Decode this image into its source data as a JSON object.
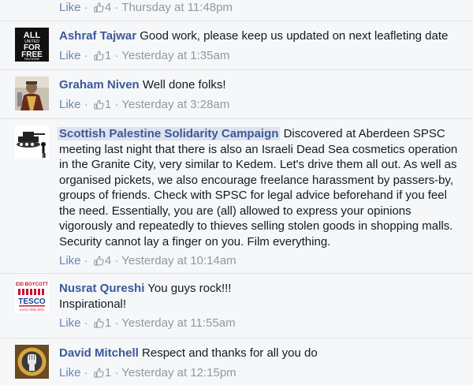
{
  "comments": [
    {
      "author": "",
      "text": "",
      "like_label": "Like",
      "likes": "4",
      "time": "Thursday at 11:48pm",
      "avatar": "none"
    },
    {
      "author": "Ashraf Tajwar",
      "text": "Good work, please keep us updated on next leafleting date",
      "like_label": "Like",
      "likes": "1",
      "time": "Yesterday at 1:35am",
      "avatar": "all-united-for-free-palestine-logo",
      "avatar_text": [
        "ALL",
        "UNITED",
        "FOR",
        "FREE",
        "PALESTINE"
      ]
    },
    {
      "author": "Graham Niven",
      "text": "Well done folks!",
      "like_label": "Like",
      "likes": "1",
      "time": "Yesterday at 3:28am",
      "avatar": "person-photo"
    },
    {
      "author": "Scottish Palestine Solidarity Campaign",
      "text": "Discovered at Aberdeen SPSC meeting last night that there is also an Israeli Dead Sea cosmetics operation in the Granite City, very similar to Kedem. Let's drive them all out. As well as organised pickets, we also encourage freelance harassment by passers-by, groups of friends. Check with SPSC for legal advice beforehand if you feel the need. Essentially, you are (all) allowed to express your opinions vigorously and repeatedly to thieves selling stolen goods in shopping malls. Security cannot lay a finger on you. Film everything.",
      "like_label": "Like",
      "likes": "4",
      "time": "Yesterday at 10:14am",
      "avatar": "tank-and-child-illustration"
    },
    {
      "author": "Nusrat Qureshi",
      "text": "You guys rock!!!",
      "text2": "Inspirational!",
      "like_label": "Like",
      "likes": "1",
      "time": "Yesterday at 11:55am",
      "avatar": "boycott-tesco-logo",
      "avatar_text": [
        "EID BOYCOTT",
        "TESCO",
        "every little kills"
      ]
    },
    {
      "author": "David Mitchell",
      "text": "Respect and thanks for all you do",
      "like_label": "Like",
      "likes": "1",
      "time": "Yesterday at 12:15pm",
      "avatar": "fist-emblem"
    }
  ],
  "colors": {
    "author": "#3b5998",
    "meta": "#9197a3",
    "like": "#6d84b4",
    "background": "#f6f7f9"
  }
}
